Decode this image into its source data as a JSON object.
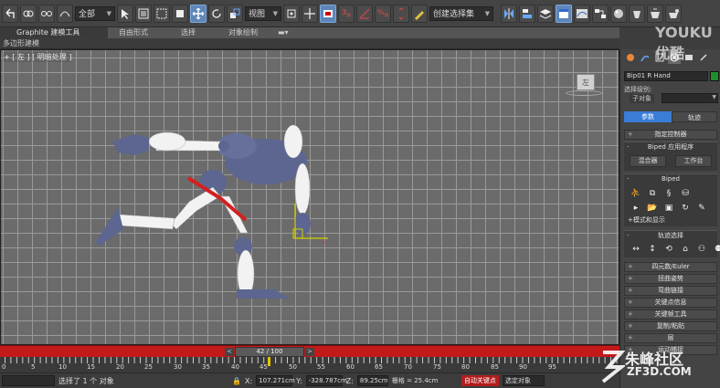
{
  "toolbar": {
    "selection_filter": "全部",
    "ref_coord": "视图",
    "named_selection": "创建选择集",
    "icons": [
      "undo-icon",
      "redo-icon",
      "link-icon",
      "unlink-icon",
      "bind-spacewarp-icon",
      "select-icon",
      "select-by-name-icon",
      "rect-region-icon",
      "window-crossing-icon",
      "move-icon",
      "rotate-icon",
      "scale-icon",
      "snap-toggle-icon",
      "angle-snap-icon",
      "percent-snap-icon",
      "spinner-snap-icon",
      "mirror-icon",
      "align-icon",
      "layer-manager-icon",
      "graphite-icon",
      "curve-editor-icon",
      "schematic-icon",
      "material-editor-icon",
      "render-setup-icon",
      "render-frame-icon",
      "render-icon"
    ]
  },
  "ribbon": {
    "tabs": [
      "Graphite 建模工具",
      "自由形式",
      "选择",
      "对象绘制"
    ],
    "sub_label": "多边形建模"
  },
  "viewport": {
    "label": "+ [ 左 ] [ 明暗处理 ]",
    "viewcube_label": "左",
    "grid_color": "#9a9a9a",
    "bg_color": "#6b6b6b"
  },
  "timeslider": {
    "frame": "42 / 100",
    "prev": "<",
    "next": ">",
    "color": "#c21a1a"
  },
  "trackbar": {
    "ticks": [
      "0",
      "5",
      "10",
      "15",
      "20",
      "25",
      "30",
      "35",
      "40",
      "45",
      "50",
      "55",
      "60",
      "65",
      "70",
      "75",
      "80",
      "85",
      "90",
      "95"
    ]
  },
  "status": {
    "selected_text": "选择了 1 个 对象",
    "x_label": "X:",
    "x_value": "107.271cm",
    "y_label": "Y:",
    "y_value": "-328.787cm",
    "z_label": "Z:",
    "z_value": "89.25cm",
    "grid_label": "栅格 = 25.4cm",
    "autokey": "自动关键点",
    "key_filter": "选定对象"
  },
  "command_panel": {
    "object_name": "Bip01 R Hand",
    "object_color": "#1f8f2a",
    "selection_level_label": "选择级别:",
    "sublevel_label": "子对象",
    "tab_params": "参数",
    "tab_track": "轨迹",
    "assign_controller": "指定控制器",
    "biped_app": "Biped 应用程序",
    "mixer_btn": "混合器",
    "workbench_btn": "工作台",
    "biped": "Biped",
    "mode_display": "+模式和显示",
    "track_select": "轨迹选择",
    "collapsed_items": [
      "四元数/Euler",
      "扭曲姿势",
      "弯曲链接",
      "关键点信息",
      "关键帧工具",
      "复制/粘贴",
      "层",
      "运动捕捉"
    ]
  },
  "watermark": {
    "youku": "YOUKU 优酷",
    "site_name": "朱峰社区",
    "site_url": "ZF3D.COM"
  }
}
